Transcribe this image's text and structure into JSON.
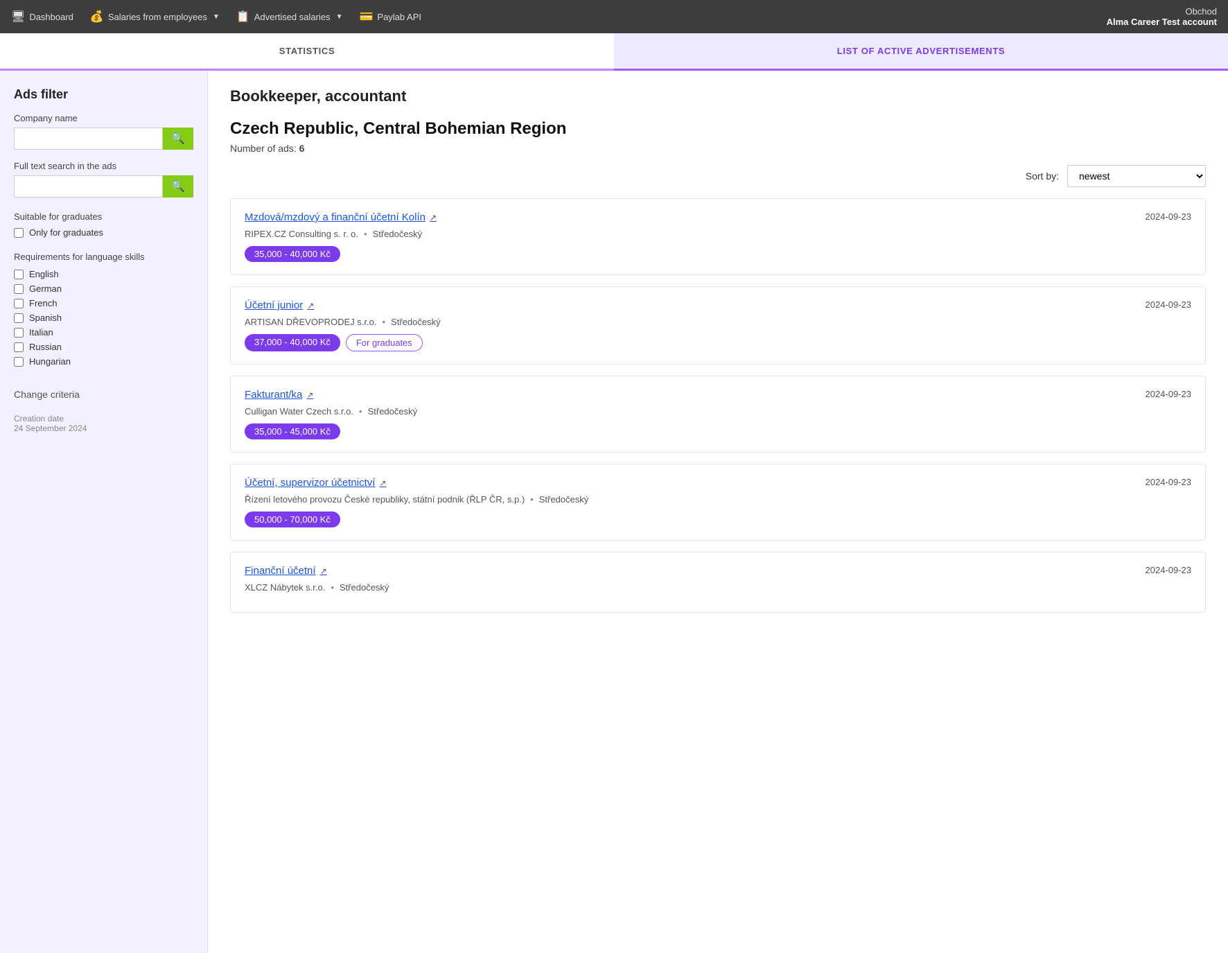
{
  "topNav": {
    "dashboard": "Dashboard",
    "salariesFromEmployees": "Salaries from employees",
    "advertisedSalaries": "Advertised salaries",
    "paylabAPI": "Paylab API",
    "account": {
      "company": "Obchod",
      "name": "Alma Career Test account"
    }
  },
  "tabs": [
    {
      "id": "statistics",
      "label": "STATISTICS",
      "active": false
    },
    {
      "id": "list",
      "label": "LIST OF ACTIVE ADVERTISEMENTS",
      "active": true
    }
  ],
  "sidebar": {
    "title": "Ads filter",
    "companyNameLabel": "Company name",
    "companyNamePlaceholder": "",
    "fullTextLabel": "Full text search in the ads",
    "fullTextPlaceholder": "",
    "graduatesTitle": "Suitable for graduates",
    "onlyForGraduates": "Only for graduates",
    "languageTitle": "Requirements for language skills",
    "languages": [
      "English",
      "German",
      "French",
      "Spanish",
      "Italian",
      "Russian",
      "Hungarian"
    ],
    "changeCriteria": "Change criteria",
    "creationDateLabel": "Creation date",
    "creationDateValue": "24 September 2024"
  },
  "content": {
    "jobTitle": "Bookkeeper, accountant",
    "regionTitle": "Czech Republic, Central Bohemian Region",
    "numberOfAdsLabel": "Number of ads:",
    "numberOfAds": "6",
    "sortByLabel": "Sort by:",
    "sortOptions": [
      "newest"
    ],
    "sortSelected": "newest",
    "jobs": [
      {
        "title": "Mzdová/mzdový a finanční účetní Kolín",
        "company": "RIPEX.CZ Consulting s. r. o.",
        "region": "Středočeský",
        "date": "2024-09-23",
        "salary": "35,000 - 40,000 Kč",
        "forGraduates": false
      },
      {
        "title": "Účetní junior",
        "company": "ARTISAN DŘEVOPRODEJ s.r.o.",
        "region": "Středočeský",
        "date": "2024-09-23",
        "salary": "37,000 - 40,000 Kč",
        "forGraduates": true
      },
      {
        "title": "Fakturant/ka",
        "company": "Culligan Water Czech s.r.o.",
        "region": "Středočeský",
        "date": "2024-09-23",
        "salary": "35,000 - 45,000 Kč",
        "forGraduates": false
      },
      {
        "title": "Účetní, supervizor účetnictví",
        "company": "Řízení letového provozu České republiky, státní podnik (ŘLP ČR, s.p.)",
        "region": "Středočeský",
        "date": "2024-09-23",
        "salary": "50,000 - 70,000 Kč",
        "forGraduates": false
      },
      {
        "title": "Finanční účetní",
        "company": "XLCZ Nábytek s.r.o.",
        "region": "Středočeský",
        "date": "2024-09-23",
        "salary": "",
        "forGraduates": false
      }
    ],
    "forGraduatesLabel": "For graduates"
  },
  "icons": {
    "search": "🔍",
    "dashboard": "🖥",
    "salaries": "💰",
    "advertised": "📋",
    "paylab": "💳",
    "external": "↗"
  }
}
